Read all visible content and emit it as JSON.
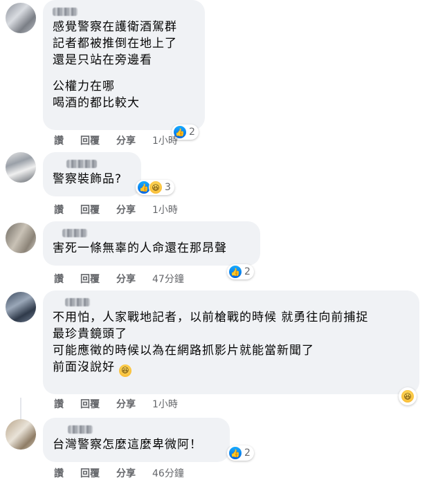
{
  "comments": [
    {
      "lines": [
        "感覺警察在護衛酒駕群",
        "記者都被推倒在地上了",
        "還是只站在旁邊看"
      ],
      "lines2": [
        "公權力在哪",
        "喝酒的都比較大"
      ],
      "reaction_count": "2",
      "actions": {
        "like": "讚",
        "reply": "回覆",
        "share": "分享",
        "time": "1小時"
      }
    },
    {
      "lines": [
        "警察裝飾品?"
      ],
      "reaction_count": "3",
      "actions": {
        "like": "讚",
        "reply": "回覆",
        "share": "分享",
        "time": "1小時"
      }
    },
    {
      "lines": [
        "害死一條無辜的人命還在那昂聲"
      ],
      "reaction_count": "2",
      "actions": {
        "like": "讚",
        "reply": "回覆",
        "share": "分享",
        "time": "47分鐘"
      }
    },
    {
      "lines": [
        "不用怕，人家戰地記者，以前槍戰的時候 就勇往向前捕捉",
        "最珍貴鏡頭了",
        "可能應徵的時候以為在網路抓影片就能當新聞了",
        "前面沒說好"
      ],
      "actions": {
        "like": "讚",
        "reply": "回覆",
        "share": "分享",
        "time": "1小時"
      }
    },
    {
      "lines": [
        "台灣警察怎麼這麼卑微阿！"
      ],
      "reaction_count": "2",
      "actions": {
        "like": "讚",
        "reply": "回覆",
        "share": "分享",
        "time": "46分鐘"
      }
    }
  ],
  "icons": {
    "like": "thumbs-up-icon",
    "haha": "laughing-face-icon"
  },
  "colors": {
    "bubble": "#f0f2f5",
    "like": "#0866ff",
    "meta": "#65676b"
  }
}
